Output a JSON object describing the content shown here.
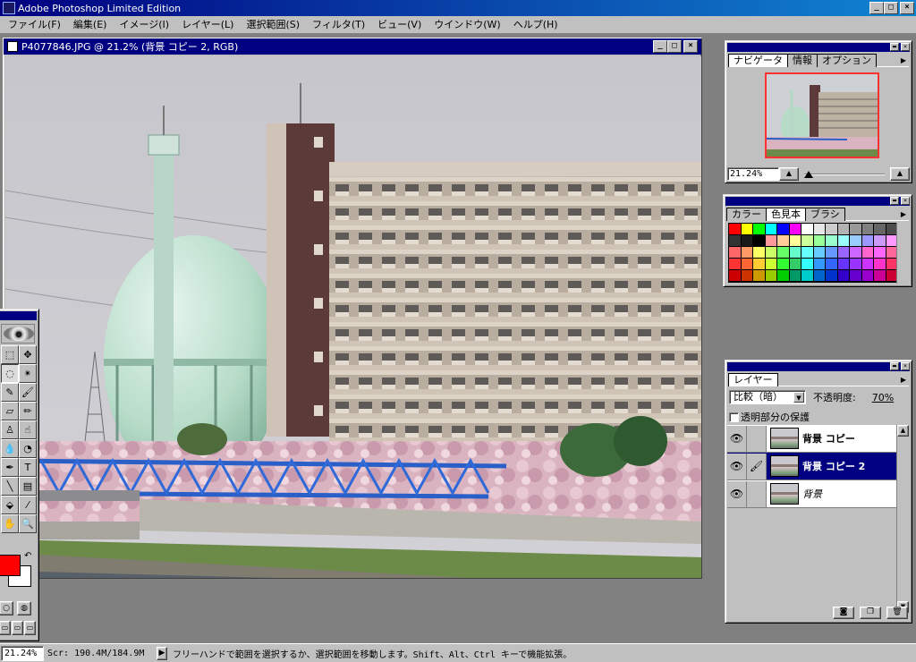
{
  "app": {
    "title": "Adobe Photoshop Limited Edition",
    "window_buttons": {
      "minimize": "_",
      "maximize": "□",
      "close": "×"
    }
  },
  "menu": {
    "items": [
      "ファイル(F)",
      "編集(E)",
      "イメージ(I)",
      "レイヤー(L)",
      "選択範囲(S)",
      "フィルタ(T)",
      "ビュー(V)",
      "ウインドウ(W)",
      "ヘルプ(H)"
    ]
  },
  "document": {
    "title": "P4077846.JPG @ 21.2% (背景 コピー 2, RGB)"
  },
  "navigator": {
    "tabs": [
      "ナビゲータ",
      "情報",
      "オプション"
    ],
    "active_tab": 0,
    "zoom": "21.24%"
  },
  "swatches": {
    "tabs": [
      "カラー",
      "色見本",
      "ブラシ"
    ],
    "active_tab": 1,
    "colors": [
      "#ff0000",
      "#ffff00",
      "#00ff00",
      "#00ffff",
      "#0000ff",
      "#ff00ff",
      "#ffffff",
      "#e6e6e6",
      "#cccccc",
      "#b3b3b3",
      "#999999",
      "#808080",
      "#666666",
      "#4d4d4d",
      "#333333",
      "#1a1a1a",
      "#000000",
      "#ff9999",
      "#ffcc99",
      "#ffff99",
      "#ccff99",
      "#99ff99",
      "#99ffcc",
      "#99ffff",
      "#99ccff",
      "#9999ff",
      "#cc99ff",
      "#ff99ff",
      "#ff6666",
      "#ff9966",
      "#ffff66",
      "#ccff66",
      "#66ff66",
      "#66ffcc",
      "#66ffff",
      "#66ccff",
      "#6699ff",
      "#9966ff",
      "#cc66ff",
      "#ff66cc",
      "#ff66ff",
      "#ff6699",
      "#ff3333",
      "#ff6633",
      "#ffcc33",
      "#ccff33",
      "#33ff33",
      "#33cc66",
      "#33ffff",
      "#3399ff",
      "#3366ff",
      "#6633ff",
      "#9933ff",
      "#cc33ff",
      "#ff33cc",
      "#ff3366",
      "#cc0000",
      "#cc3300",
      "#cc9900",
      "#99cc00",
      "#00cc00",
      "#009966",
      "#00cccc",
      "#0066cc",
      "#0033cc",
      "#3300cc",
      "#6600cc",
      "#9900cc",
      "#cc0099",
      "#cc0033"
    ]
  },
  "layers": {
    "tab": "レイヤー",
    "blend_mode": "比較（暗）",
    "opacity_label": "不透明度:",
    "opacity_value": "70%",
    "preserve_label": "透明部分の保護",
    "items": [
      {
        "name": "背景 コピー",
        "active": false,
        "italic": false
      },
      {
        "name": "背景 コピー 2",
        "active": true,
        "italic": false
      },
      {
        "name": "背景",
        "active": false,
        "italic": true
      }
    ]
  },
  "status": {
    "zoom": "21.24%",
    "scratch": "Scr: 190.4M/184.9M",
    "hint": "フリーハンドで範囲を選択するか、選択範囲を移動します。Shift、Alt、Ctrl キーで機能拡張。"
  },
  "tools": [
    {
      "name": "marquee-tool",
      "glyph": "⬚"
    },
    {
      "name": "move-tool",
      "glyph": "✥"
    },
    {
      "name": "lasso-tool",
      "glyph": "◌"
    },
    {
      "name": "magic-wand-tool",
      "glyph": "✴"
    },
    {
      "name": "airbrush-tool",
      "glyph": "✎"
    },
    {
      "name": "paintbrush-tool",
      "glyph": "🖌"
    },
    {
      "name": "eraser-tool",
      "glyph": "▱"
    },
    {
      "name": "pencil-tool",
      "glyph": "✏"
    },
    {
      "name": "rubber-stamp-tool",
      "glyph": "♙"
    },
    {
      "name": "smudge-tool",
      "glyph": "☝"
    },
    {
      "name": "blur-tool",
      "glyph": "💧"
    },
    {
      "name": "dodge-tool",
      "glyph": "◔"
    },
    {
      "name": "pen-tool",
      "glyph": "✒"
    },
    {
      "name": "type-tool",
      "glyph": "T"
    },
    {
      "name": "line-tool",
      "glyph": "╲"
    },
    {
      "name": "gradient-tool",
      "glyph": "▤"
    },
    {
      "name": "paint-bucket-tool",
      "glyph": "⬙"
    },
    {
      "name": "eyedropper-tool",
      "glyph": "⁄"
    },
    {
      "name": "hand-tool",
      "glyph": "✋"
    },
    {
      "name": "zoom-tool",
      "glyph": "🔍"
    }
  ]
}
